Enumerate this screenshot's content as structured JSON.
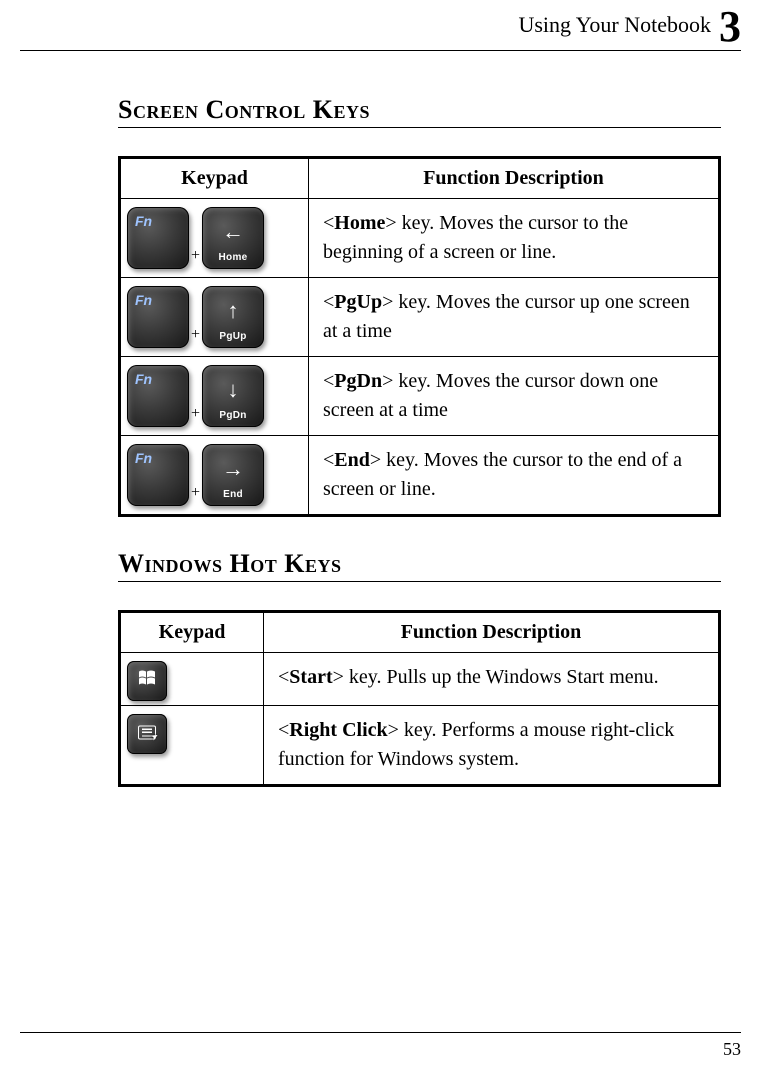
{
  "header": {
    "title": "Using Your Notebook",
    "chapter_number": "3"
  },
  "footer": {
    "page_number": "53"
  },
  "sections": {
    "screen_control": {
      "heading": "Screen Control Keys",
      "col_keypad": "Keypad",
      "col_desc": "Function Description",
      "rows": [
        {
          "fn": "Fn",
          "plus": "+",
          "arrow": "←",
          "sub": "Home",
          "key_name": "Home",
          "desc_before": "<",
          "desc_after": "> key. Moves the cursor to the beginning of a screen or line."
        },
        {
          "fn": "Fn",
          "plus": "+",
          "arrow": "↑",
          "sub": "PgUp",
          "key_name": "PgUp",
          "desc_before": "<",
          "desc_after": "> key. Moves the cursor up one screen at a time"
        },
        {
          "fn": "Fn",
          "plus": "+",
          "arrow": "↓",
          "sub": "PgDn",
          "key_name": "PgDn",
          "desc_before": "<",
          "desc_after": "> key. Moves the cursor down one screen at a time"
        },
        {
          "fn": "Fn",
          "plus": "+",
          "arrow": "→",
          "sub": "End",
          "key_name": "End",
          "desc_before": "<",
          "desc_after": "> key. Moves the cursor to the end of a screen or line."
        }
      ]
    },
    "windows_hot": {
      "heading": "Windows Hot Keys",
      "col_keypad": "Keypad",
      "col_desc": "Function Description",
      "rows": [
        {
          "icon": "windows",
          "key_name": "Start",
          "desc_before": "<",
          "desc_after": "> key. Pulls up the Windows Start menu."
        },
        {
          "icon": "menu",
          "key_name": "Right Click",
          "desc_before": "<",
          "desc_after": "> key. Performs a mouse right-click function for Windows system."
        }
      ]
    }
  }
}
